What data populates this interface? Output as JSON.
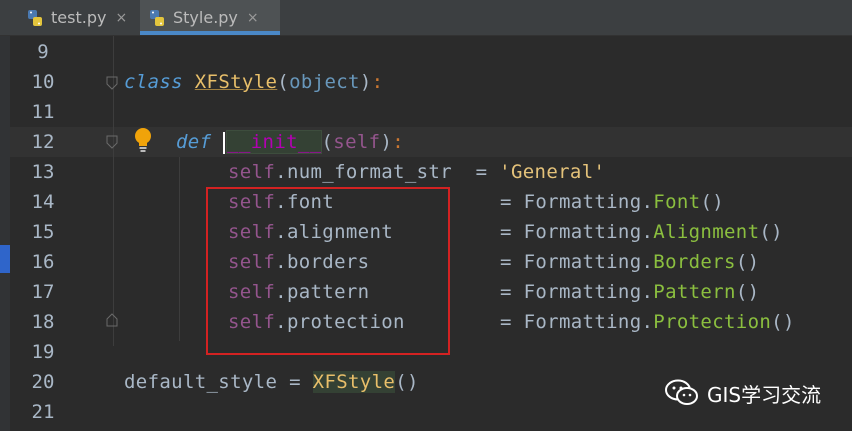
{
  "tabs": [
    {
      "label": "test.py",
      "close": "×"
    },
    {
      "label": "Style.py",
      "close": "×"
    }
  ],
  "line_numbers": [
    "9",
    "10",
    "11",
    "12",
    "13",
    "14",
    "15",
    "16",
    "17",
    "18",
    "19",
    "20",
    "21"
  ],
  "code": {
    "l10": {
      "kw": "class",
      "name": "XFStyle",
      "open": "(",
      "base": "object",
      "close": ")",
      "colon": ":"
    },
    "l12": {
      "kw": "def",
      "name": "__init__",
      "open": "(",
      "self": "self",
      "close": ")",
      "colon": ":"
    },
    "l13": {
      "self": "self",
      "attr": ".num_format_str  ",
      "eq": "=",
      "value": "'General'"
    },
    "attrs": [
      {
        "self": "self",
        "attr": ".font",
        "eq": "=",
        "mod": "Formatting.",
        "call": "Font",
        "paren": "()"
      },
      {
        "self": "self",
        "attr": ".alignment",
        "eq": "=",
        "mod": "Formatting.",
        "call": "Alignment",
        "paren": "()"
      },
      {
        "self": "self",
        "attr": ".borders",
        "eq": "=",
        "mod": "Formatting.",
        "call": "Borders",
        "paren": "()"
      },
      {
        "self": "self",
        "attr": ".pattern",
        "eq": "=",
        "mod": "Formatting.",
        "call": "Pattern",
        "paren": "()"
      },
      {
        "self": "self",
        "attr": ".protection",
        "eq": "=",
        "mod": "Formatting.",
        "call": "Protection",
        "paren": "()"
      }
    ],
    "l20": {
      "var": "default_style",
      "eq": "=",
      "call": "XFStyle",
      "paren": "()"
    }
  },
  "watermark": {
    "text": "GIS学习交流",
    "icon": "wechat-icon"
  },
  "colors": {
    "keyword": "#569cd6",
    "class": "#e8bf6a",
    "self": "#94558d",
    "call": "#8bbf3f",
    "string": "#e4c27a",
    "highlight_box": "#d32222"
  }
}
